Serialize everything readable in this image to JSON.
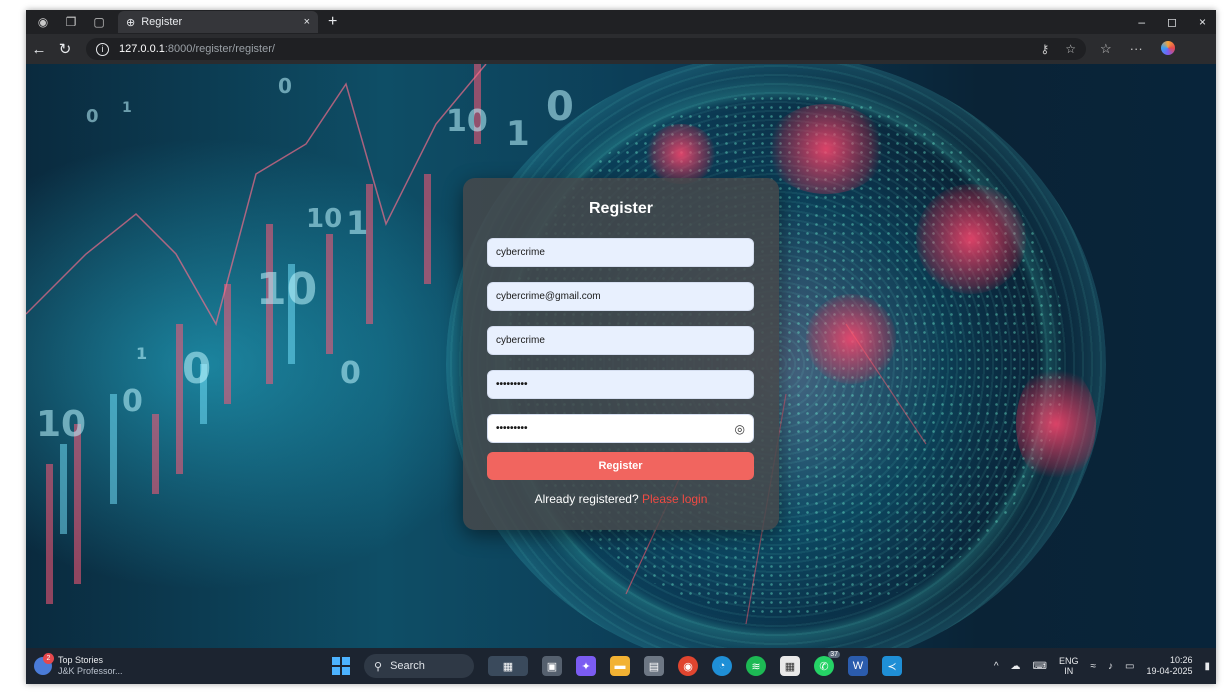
{
  "browser": {
    "tab_title": "Register",
    "tab_close": "×",
    "new_tab": "+",
    "url_host": "127.0.0.1",
    "url_path": ":8000/register/register/",
    "window_controls": [
      "–",
      "◻",
      "×"
    ]
  },
  "form": {
    "title": "Register",
    "fields": [
      {
        "value": "cybercrime"
      },
      {
        "value": "cybercrime@gmail.com"
      },
      {
        "value": "cybercrime"
      },
      {
        "value": "•••••••••"
      },
      {
        "value": "•••••••••"
      }
    ],
    "submit_label": "Register",
    "login_prompt": "Already registered?",
    "login_link": "Please login"
  },
  "background": {
    "digits": [
      "0",
      "1",
      "0",
      "10",
      "1",
      "0",
      "10",
      "0",
      "1",
      "0",
      "10",
      "1",
      "10",
      "0"
    ]
  },
  "taskbar": {
    "weather_title": "Top Stories",
    "weather_sub": "J&K Professor...",
    "weather_badge": "2",
    "search_label": "Search",
    "whatsapp_badge": "37",
    "lang_top": "ENG",
    "lang_bottom": "IN",
    "time": "10:26",
    "date": "19-04-2025"
  },
  "colors": {
    "accent_button": "#f1655f",
    "login_link": "#f14a43",
    "card_bg": "rgba(70,72,74,0.86)",
    "input_bg": "#e8f0fe"
  }
}
